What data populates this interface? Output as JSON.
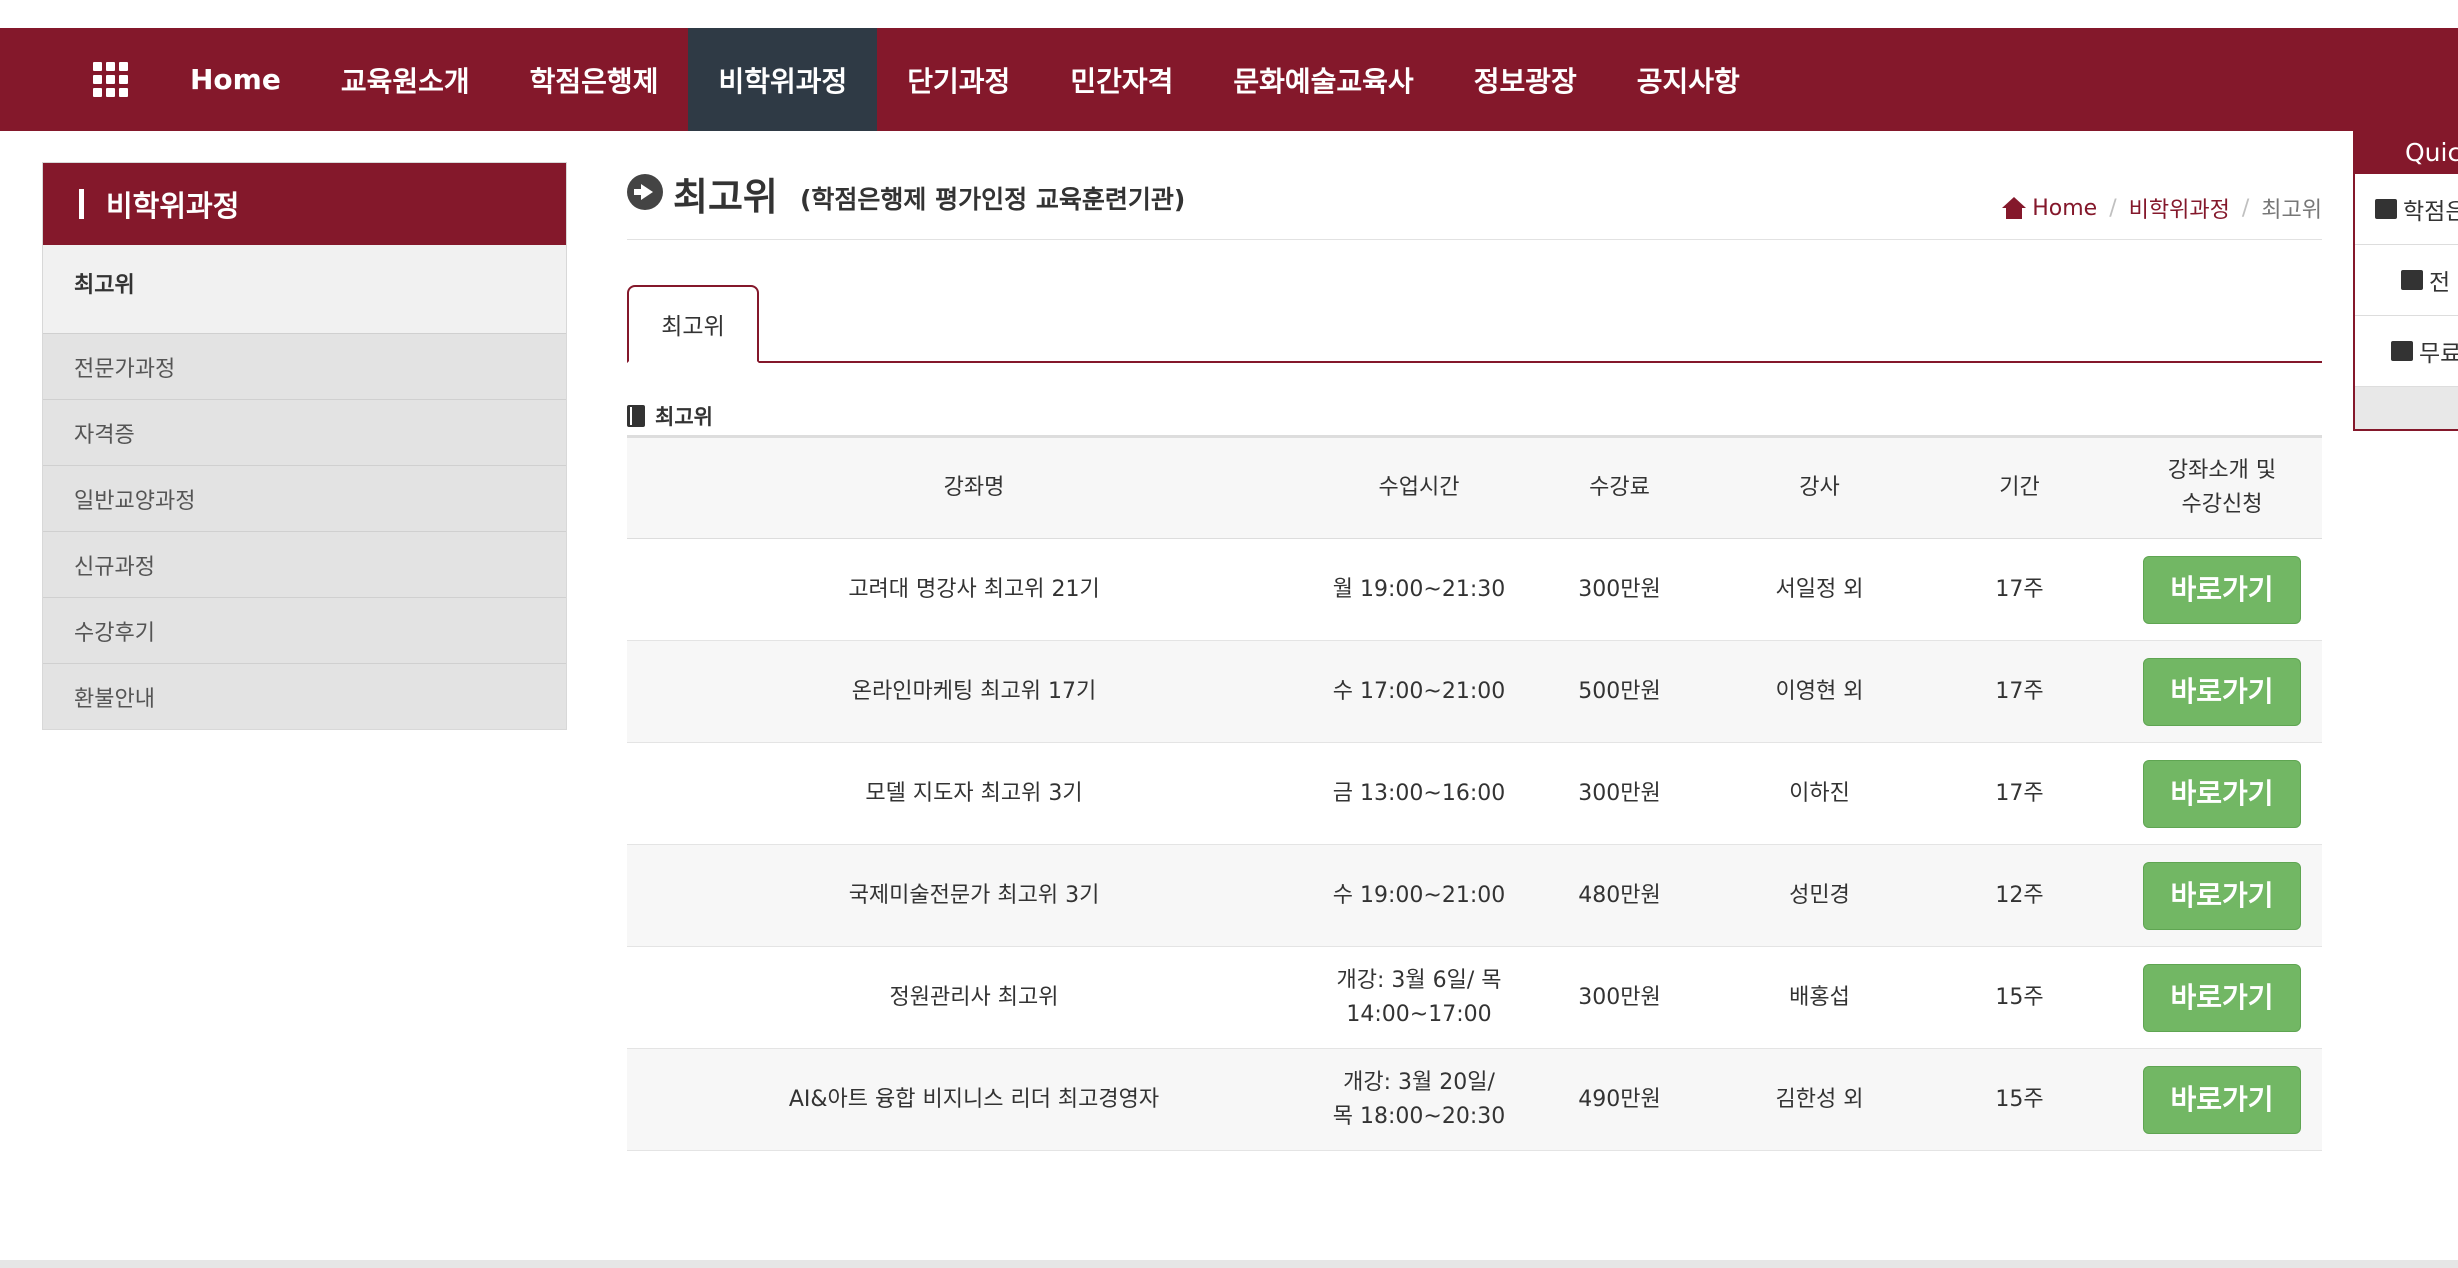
{
  "nav": {
    "items": [
      "Home",
      "교육원소개",
      "학점은행제",
      "비학위과정",
      "단기과정",
      "민간자격",
      "문화예술교육사",
      "정보광장",
      "공지사항"
    ],
    "active_index": 3,
    "menu_icon": "grid-icon"
  },
  "sidebar": {
    "title": "비학위과정",
    "items": [
      "최고위",
      "전문가과정",
      "자격증",
      "일반교양과정",
      "신규과정",
      "수강후기",
      "환불안내"
    ],
    "active_index": 0
  },
  "page": {
    "title": "최고위",
    "subtitle": "(학점은행제 평가인정 교육훈련기관)"
  },
  "breadcrumb": {
    "home": "Home",
    "section": "비학위과정",
    "current": "최고위",
    "separator": "/"
  },
  "tabs": [
    "최고위"
  ],
  "section_label": "최고위",
  "table": {
    "headers": [
      "강좌명",
      "수업시간",
      "수강료",
      "강사",
      "기간",
      "강좌소개 및\n수강신청"
    ],
    "rows": [
      {
        "name": "고려대 명강사 최고위 21기",
        "time": "월 19:00~21:30",
        "fee": "300만원",
        "teacher": "서일정 외",
        "period": "17주",
        "action": "바로가기"
      },
      {
        "name": "온라인마케팅 최고위 17기",
        "time": "수 17:00~21:00",
        "fee": "500만원",
        "teacher": "이영현 외",
        "period": "17주",
        "action": "바로가기"
      },
      {
        "name": "모델 지도자 최고위 3기",
        "time": "금 13:00~16:00",
        "fee": "300만원",
        "teacher": "이하진",
        "period": "17주",
        "action": "바로가기"
      },
      {
        "name": "국제미술전문가 최고위 3기",
        "time": "수 19:00~21:00",
        "fee": "480만원",
        "teacher": "성민경",
        "period": "12주",
        "action": "바로가기"
      },
      {
        "name": "정원관리사 최고위",
        "time": "개강: 3월 6일/ 목\n14:00~17:00",
        "fee": "300만원",
        "teacher": "배홍섭",
        "period": "15주",
        "action": "바로가기"
      },
      {
        "name": "AI&아트 융합 비지니스 리더 최고경영자",
        "time": "개강: 3월 20일/\n목 18:00~20:30",
        "fee": "490만원",
        "teacher": "김한성 외",
        "period": "15주",
        "action": "바로가기"
      }
    ]
  },
  "quick_menu": {
    "title": "Quic",
    "items": [
      {
        "label": "학점은",
        "icon": "calendar-icon"
      },
      {
        "label": "전",
        "icon": "cart-icon"
      },
      {
        "label": "무료",
        "icon": "folder-icon"
      }
    ]
  },
  "colors": {
    "brand": "#84182b",
    "nav_active": "#2f3a45",
    "button": "#72b764"
  }
}
